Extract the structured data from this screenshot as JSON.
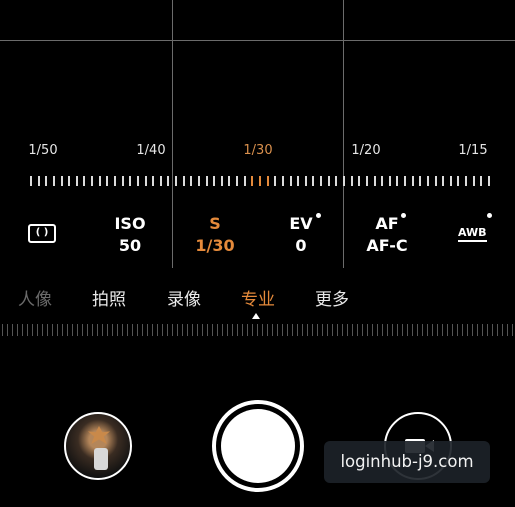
{
  "shutter_scale": {
    "labels": [
      "1/50",
      "1/40",
      "1/30",
      "1/20",
      "1/15"
    ],
    "selected": "1/30"
  },
  "params": {
    "iso": {
      "label": "ISO",
      "value": "50"
    },
    "shutter": {
      "label": "S",
      "value": "1/30"
    },
    "ev": {
      "label": "EV",
      "value": "0"
    },
    "af": {
      "label": "AF",
      "value": "AF-C"
    },
    "awb": {
      "label": "AWB"
    },
    "metering": {
      "label": "( )"
    }
  },
  "modes": {
    "items": [
      "人像",
      "拍照",
      "录像",
      "专业",
      "更多"
    ],
    "active": "专业"
  },
  "icons": {
    "metering": "metering-icon",
    "gallery": "gallery-thumbnail",
    "shutter": "shutter-button",
    "video": "video-camera-icon"
  },
  "colors": {
    "accent": "#e58a3b",
    "background": "#000000"
  },
  "watermark": {
    "text": "loginhub-j9.com"
  }
}
